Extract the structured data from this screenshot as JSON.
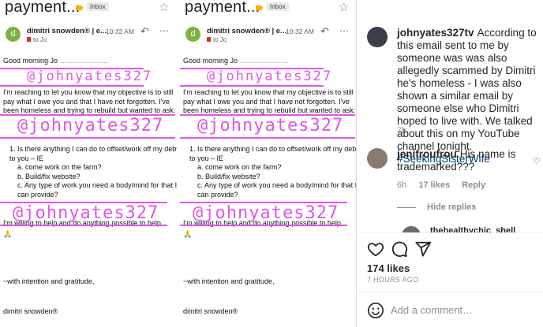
{
  "email": {
    "subject": "payment...",
    "label": "Inbox",
    "sender_name": "dimitri snowden® | e...",
    "sender_initial": "d",
    "time": "10:32 AM",
    "to": "to Jo",
    "greeting": "Good morning Jo",
    "paragraph1": "I'm reaching to let you know that my objective is to still pay what I owe you and that I have not forgotten.  I've been homeless and trying to rebuild but wanted to ask:",
    "list_item": "1.  Is there anything I can do to offset/work off my debt to you – IE",
    "sub_items": [
      "a.  come work on the farm?",
      "b.  Build/fix website?",
      "c.  Any type of work you need a body/mind for that I can provide?"
    ],
    "paragraph2": "I'm willing to help and do anything possible to help",
    "emoji": "🙏",
    "closing": "~with intention and gratitude,",
    "signature": "dimitri snowden®",
    "watermark": "@johnyates327"
  },
  "comments": [
    {
      "username": "johnyates327tv",
      "text": "According to this email sent to me by someone was was also allegedly scammed by Dimitri he's homeless - I was also shown a similar email by someone else who Dimitri hoped to live with. We talked about this on my YouTube channel tonight.",
      "hashtag": "#SeekingSisterWife",
      "time": "7h",
      "avatar_color": "#3a3f4a"
    },
    {
      "username": "jenifroufrou",
      "text": "His name is trademarked???",
      "time": "6h",
      "likes": "17 likes",
      "reply": "Reply",
      "avatar_color": "#8a7a70"
    }
  ],
  "hide_replies": "Hide replies",
  "partial_comment_user": "thehealthychic_shell",
  "likes_count": "174 likes",
  "posted_time": "7 HOURS AGO",
  "add_comment_placeholder": "Add a comment…",
  "icons": {
    "like": "heart-icon",
    "comment": "comment-icon",
    "share": "share-icon",
    "emoji": "emoji-icon"
  }
}
